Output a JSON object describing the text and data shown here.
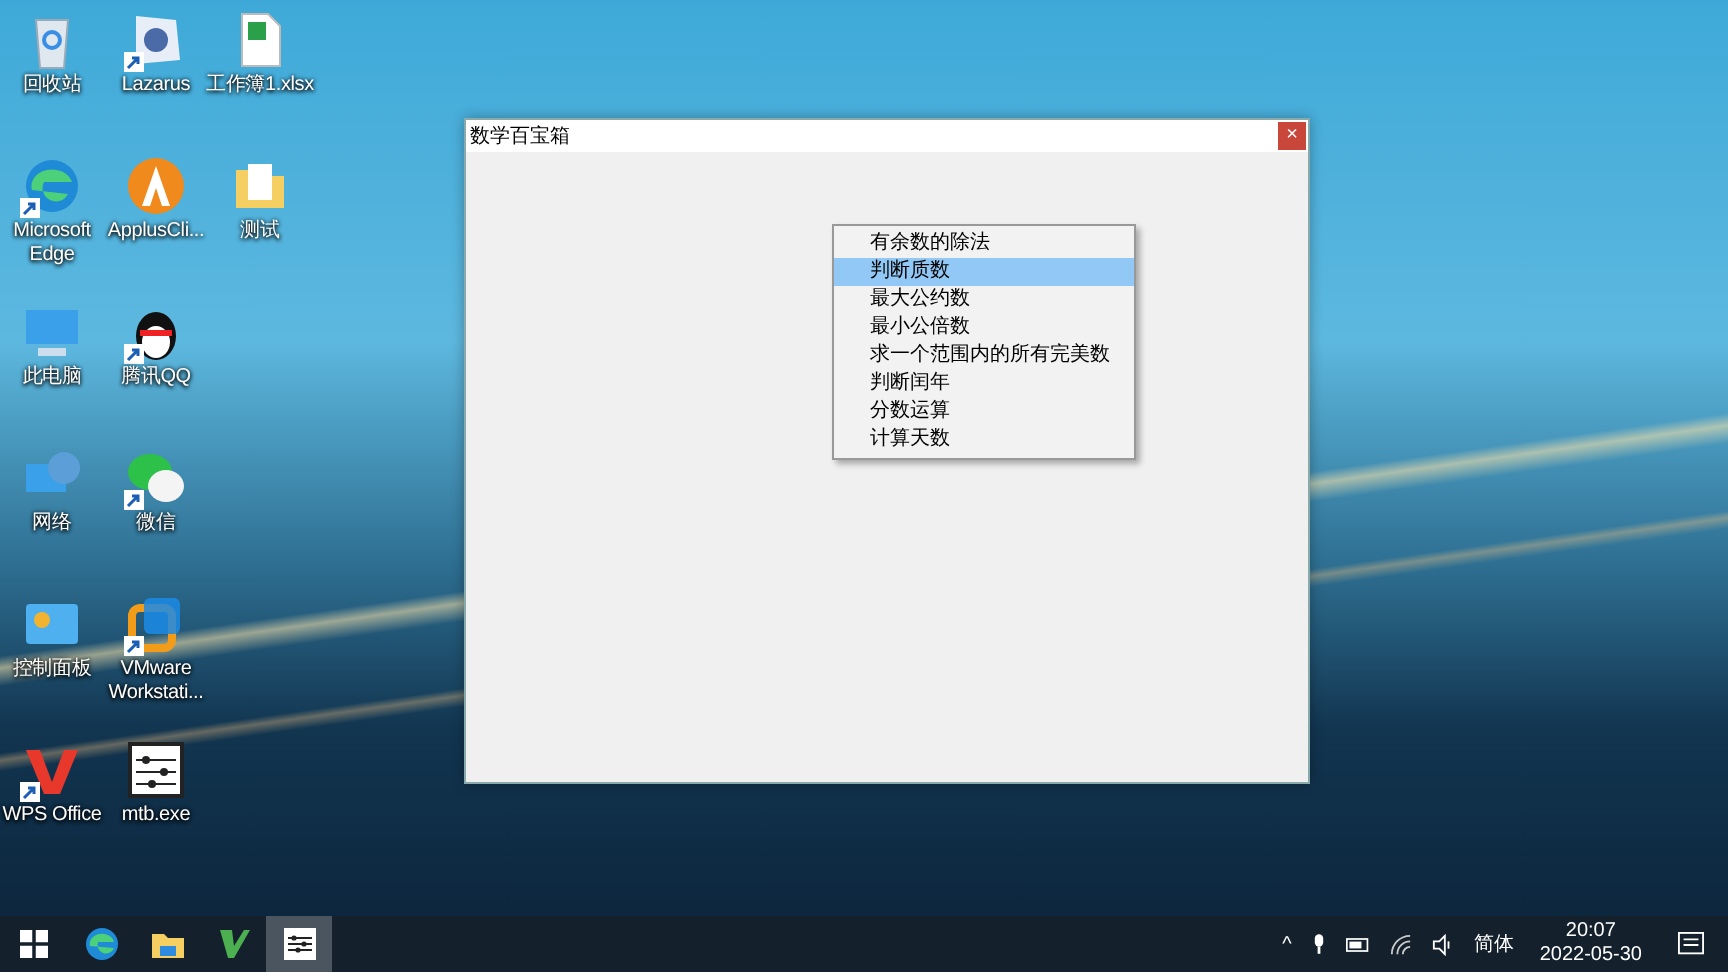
{
  "desktop_icons": [
    {
      "label": "回收站",
      "shortcut": false
    },
    {
      "label": "Microsoft Edge",
      "shortcut": true
    },
    {
      "label": "此电脑",
      "shortcut": false
    },
    {
      "label": "网络",
      "shortcut": false
    },
    {
      "label": "控制面板",
      "shortcut": false
    },
    {
      "label": "WPS Office",
      "shortcut": true
    },
    {
      "label": "Lazarus",
      "shortcut": true
    },
    {
      "label": "ApplusCli...",
      "shortcut": false
    },
    {
      "label": "腾讯QQ",
      "shortcut": true
    },
    {
      "label": "微信",
      "shortcut": true
    },
    {
      "label": "VMware Workstati...",
      "shortcut": true
    },
    {
      "label": "mtb.exe",
      "shortcut": false
    },
    {
      "label": "工作簿1.xlsx",
      "shortcut": false
    },
    {
      "label": "测试",
      "shortcut": false
    }
  ],
  "window": {
    "title": "数学百宝箱",
    "close": "×"
  },
  "menu": {
    "items": [
      {
        "label": "有余数的除法",
        "selected": false
      },
      {
        "label": "判断质数",
        "selected": true
      },
      {
        "label": "最大公约数",
        "selected": false
      },
      {
        "label": "最小公倍数",
        "selected": false
      },
      {
        "label": "求一个范围内的所有完美数",
        "selected": false
      },
      {
        "label": "判断闰年",
        "selected": false
      },
      {
        "label": "分数运算",
        "selected": false
      },
      {
        "label": "计算天数",
        "selected": false
      }
    ]
  },
  "taskbar": {
    "apps": [
      {
        "selected": false
      },
      {
        "selected": false
      },
      {
        "selected": false
      },
      {
        "selected": true
      }
    ],
    "tray": {
      "caret": "^",
      "ime": "简体",
      "time": "20:07",
      "date": "2022-05-30"
    }
  }
}
